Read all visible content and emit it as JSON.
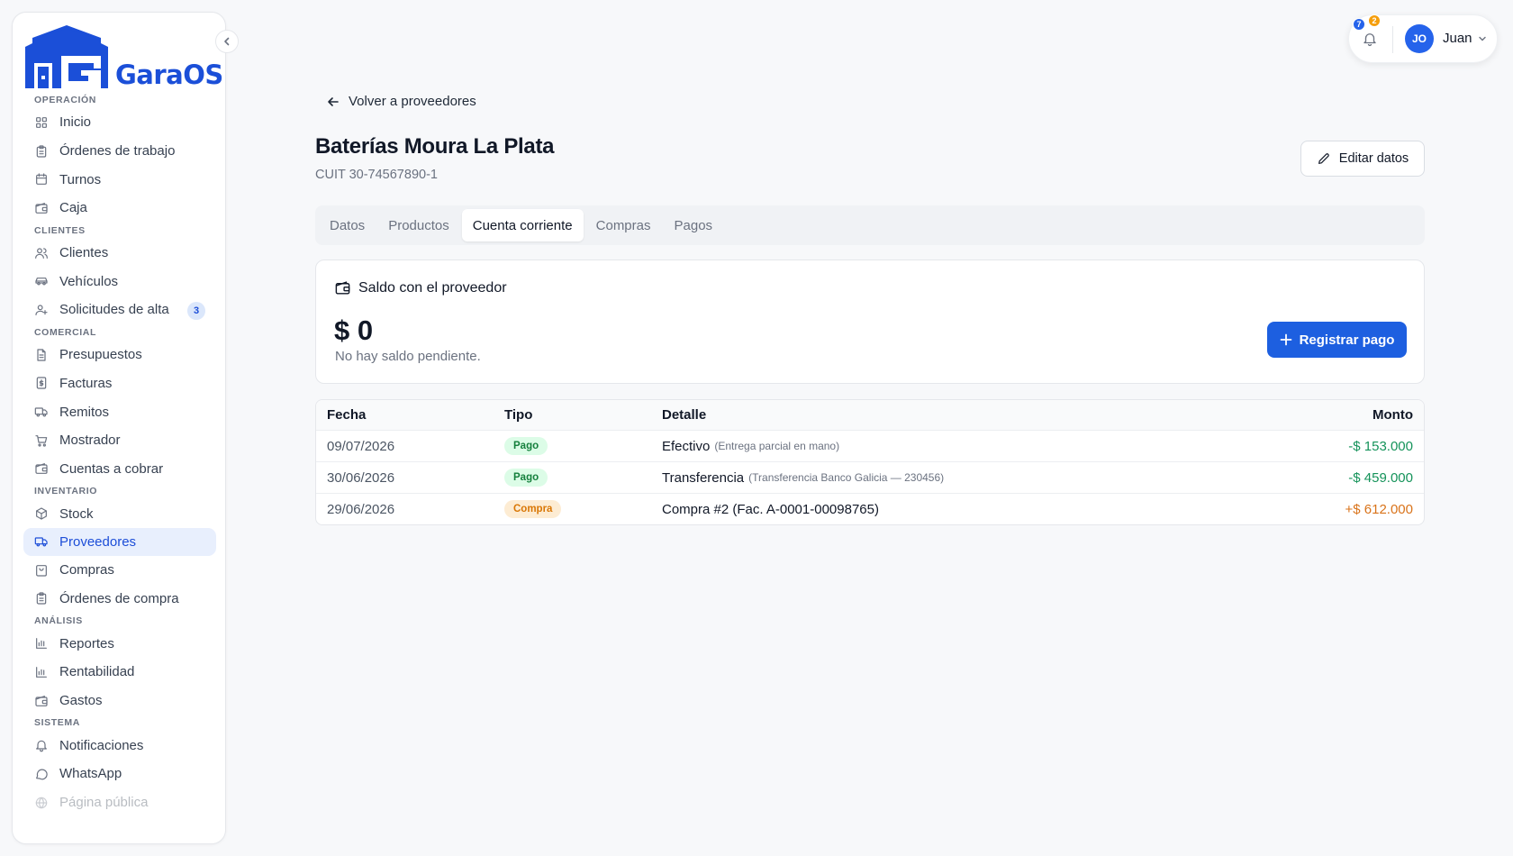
{
  "app": {
    "brand": "GaraOS"
  },
  "sidebar": {
    "collapse_icon": "chevron-left-icon",
    "sections": [
      {
        "title": "OPERACIÓN",
        "items": [
          {
            "label": "Inicio",
            "icon": "grid-icon"
          },
          {
            "label": "Órdenes de trabajo",
            "icon": "clipboard-icon"
          },
          {
            "label": "Turnos",
            "icon": "calendar-icon"
          },
          {
            "label": "Caja",
            "icon": "wallet-icon"
          }
        ]
      },
      {
        "title": "CLIENTES",
        "items": [
          {
            "label": "Clientes",
            "icon": "users-icon"
          },
          {
            "label": "Vehículos",
            "icon": "car-icon"
          },
          {
            "label": "Solicitudes de alta",
            "icon": "user-plus-icon",
            "badge": "3"
          }
        ]
      },
      {
        "title": "COMERCIAL",
        "items": [
          {
            "label": "Presupuestos",
            "icon": "file-text-icon"
          },
          {
            "label": "Facturas",
            "icon": "receipt-icon"
          },
          {
            "label": "Remitos",
            "icon": "truck-icon"
          },
          {
            "label": "Mostrador",
            "icon": "cart-icon"
          },
          {
            "label": "Cuentas a cobrar",
            "icon": "wallet-icon"
          }
        ]
      },
      {
        "title": "INVENTARIO",
        "items": [
          {
            "label": "Stock",
            "icon": "package-icon"
          },
          {
            "label": "Proveedores",
            "icon": "truck-icon",
            "active": true
          },
          {
            "label": "Compras",
            "icon": "shopping-bag-icon"
          },
          {
            "label": "Órdenes de compra",
            "icon": "clipboard-icon"
          }
        ]
      },
      {
        "title": "ANÁLISIS",
        "items": [
          {
            "label": "Reportes",
            "icon": "bar-chart-icon"
          },
          {
            "label": "Rentabilidad",
            "icon": "bar-chart-icon"
          },
          {
            "label": "Gastos",
            "icon": "wallet-icon"
          }
        ]
      },
      {
        "title": "SISTEMA",
        "items": [
          {
            "label": "Notificaciones",
            "icon": "bell-icon"
          },
          {
            "label": "WhatsApp",
            "icon": "message-icon"
          },
          {
            "label": "Página pública",
            "icon": "globe-icon"
          }
        ]
      }
    ]
  },
  "userbar": {
    "notif_count_blue": "7",
    "notif_count_orange": "2",
    "avatar_initials": "JO",
    "user_name": "Juan"
  },
  "main": {
    "back_label": "Volver a proveedores",
    "title": "Baterías Moura La Plata",
    "subtitle": "CUIT 30-74567890-1",
    "edit_label": "Editar datos",
    "tabs": [
      "Datos",
      "Productos",
      "Cuenta corriente",
      "Compras",
      "Pagos"
    ],
    "active_tab": "Cuenta corriente",
    "balance": {
      "heading": "Saldo con el proveedor",
      "amount": "$ 0",
      "note": "No hay saldo pendiente.",
      "pay_label": "Registrar pago"
    },
    "table": {
      "headers": {
        "fecha": "Fecha",
        "tipo": "Tipo",
        "detalle": "Detalle",
        "monto": "Monto"
      },
      "rows": [
        {
          "fecha": "09/07/2026",
          "tipo": "Pago",
          "tipo_kind": "pago",
          "detalle": "Efectivo",
          "nota": "(Entrega parcial en mano)",
          "monto": "-$ 153.000",
          "sign": "neg"
        },
        {
          "fecha": "30/06/2026",
          "tipo": "Pago",
          "tipo_kind": "pago",
          "detalle": "Transferencia",
          "nota": "(Transferencia Banco Galicia — 230456)",
          "monto": "-$ 459.000",
          "sign": "neg"
        },
        {
          "fecha": "29/06/2026",
          "tipo": "Compra",
          "tipo_kind": "compra",
          "detalle": "Compra #2 (Fac. A-0001-00098765)",
          "nota": "",
          "monto": "+$ 612.000",
          "sign": "pos"
        }
      ]
    }
  },
  "colors": {
    "accent": "#1d5fe0",
    "brand": "#1b4fd8",
    "pago_green": "#15803d",
    "compra_orange": "#d97706"
  }
}
